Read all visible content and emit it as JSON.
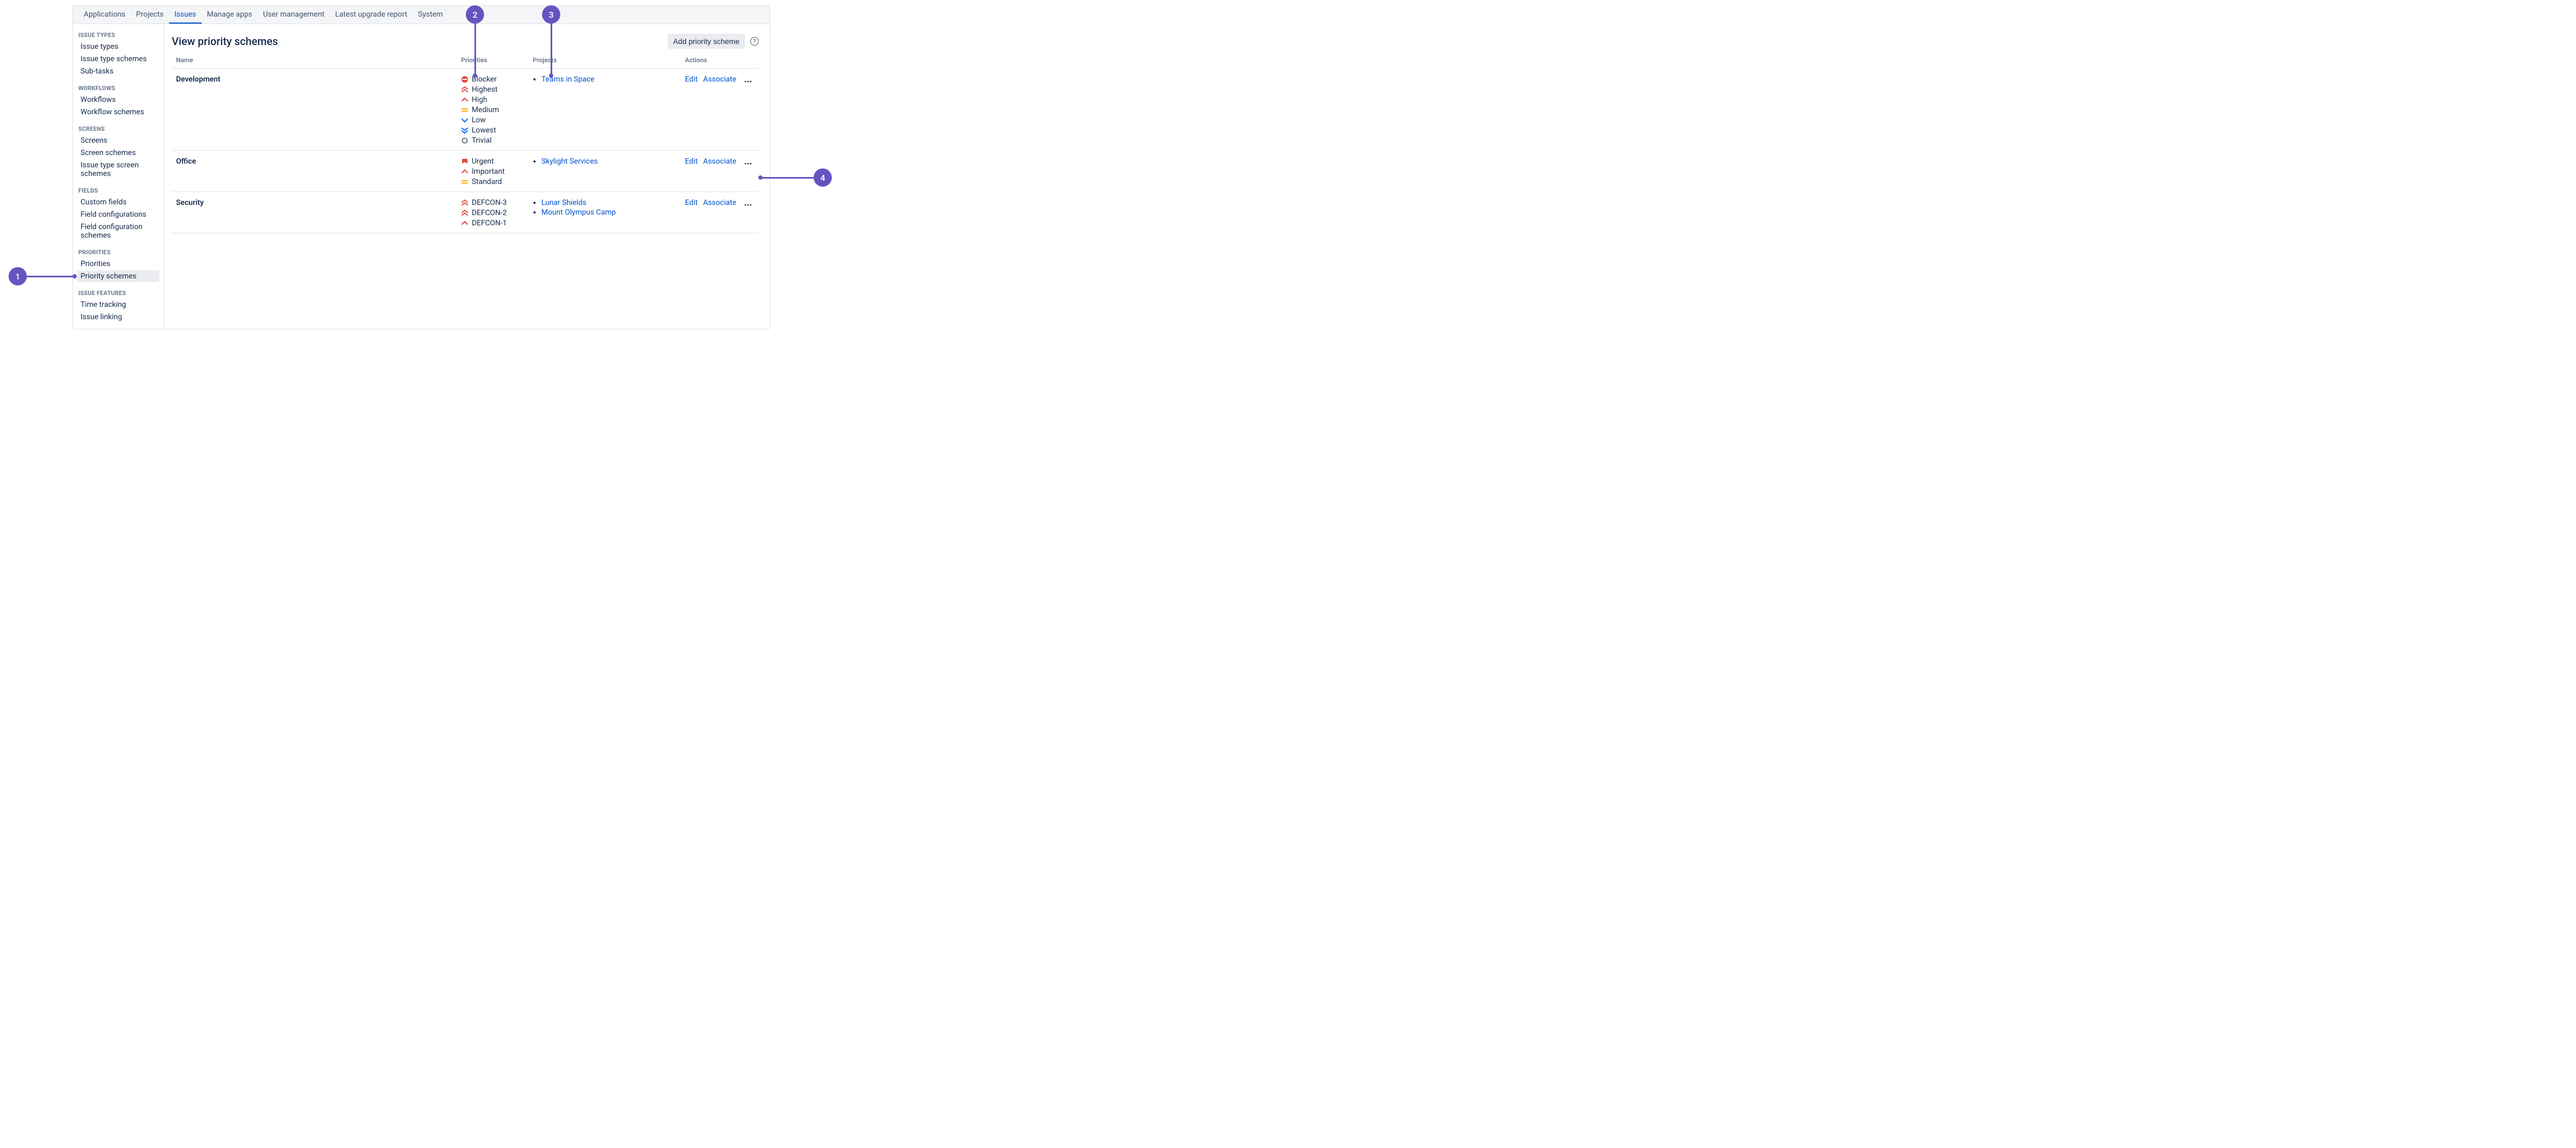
{
  "topnav": {
    "tabs": [
      {
        "label": "Applications"
      },
      {
        "label": "Projects"
      },
      {
        "label": "Issues"
      },
      {
        "label": "Manage apps"
      },
      {
        "label": "User management"
      },
      {
        "label": "Latest upgrade report"
      },
      {
        "label": "System"
      }
    ],
    "active_index": 2
  },
  "sidebar": {
    "groups": [
      {
        "title": "ISSUE TYPES",
        "items": [
          {
            "label": "Issue types"
          },
          {
            "label": "Issue type schemes"
          },
          {
            "label": "Sub-tasks"
          }
        ]
      },
      {
        "title": "WORKFLOWS",
        "items": [
          {
            "label": "Workflows"
          },
          {
            "label": "Workflow schemes"
          }
        ]
      },
      {
        "title": "SCREENS",
        "items": [
          {
            "label": "Screens"
          },
          {
            "label": "Screen schemes"
          },
          {
            "label": "Issue type screen schemes"
          }
        ]
      },
      {
        "title": "FIELDS",
        "items": [
          {
            "label": "Custom fields"
          },
          {
            "label": "Field configurations"
          },
          {
            "label": "Field configuration schemes"
          }
        ]
      },
      {
        "title": "PRIORITIES",
        "items": [
          {
            "label": "Priorities"
          },
          {
            "label": "Priority schemes"
          }
        ],
        "active_item_index": 1
      },
      {
        "title": "ISSUE FEATURES",
        "items": [
          {
            "label": "Time tracking"
          },
          {
            "label": "Issue linking"
          }
        ]
      }
    ]
  },
  "main": {
    "title": "View priority schemes",
    "add_button_label": "Add priority scheme",
    "columns": {
      "name": "Name",
      "priorities": "Priorities",
      "projects": "Projects",
      "actions": "Actions"
    },
    "schemes": [
      {
        "name": "Development",
        "priorities": [
          {
            "icon": "blocker",
            "label": "Blocker"
          },
          {
            "icon": "highest",
            "label": "Highest"
          },
          {
            "icon": "high",
            "label": "High"
          },
          {
            "icon": "medium",
            "label": "Medium"
          },
          {
            "icon": "low",
            "label": "Low"
          },
          {
            "icon": "lowest",
            "label": "Lowest"
          },
          {
            "icon": "trivial",
            "label": "Trivial"
          }
        ],
        "projects": [
          "Teams in Space"
        ],
        "actions": [
          "Edit",
          "Associate"
        ]
      },
      {
        "name": "Office",
        "priorities": [
          {
            "icon": "urgent",
            "label": "Urgent"
          },
          {
            "icon": "high",
            "label": "Important"
          },
          {
            "icon": "medium",
            "label": "Standard"
          }
        ],
        "projects": [
          "Skylight Services"
        ],
        "actions": [
          "Edit",
          "Associate"
        ]
      },
      {
        "name": "Security",
        "priorities": [
          {
            "icon": "highest",
            "label": "DEFCON-3"
          },
          {
            "icon": "highest",
            "label": "DEFCON-2"
          },
          {
            "icon": "high",
            "label": "DEFCON-1"
          }
        ],
        "projects": [
          "Lunar Shields",
          "Mount Olympus Camp"
        ],
        "actions": [
          "Edit",
          "Associate"
        ]
      }
    ]
  },
  "annotations": {
    "callout_1": "1",
    "callout_2": "2",
    "callout_3": "3",
    "callout_4": "4"
  }
}
